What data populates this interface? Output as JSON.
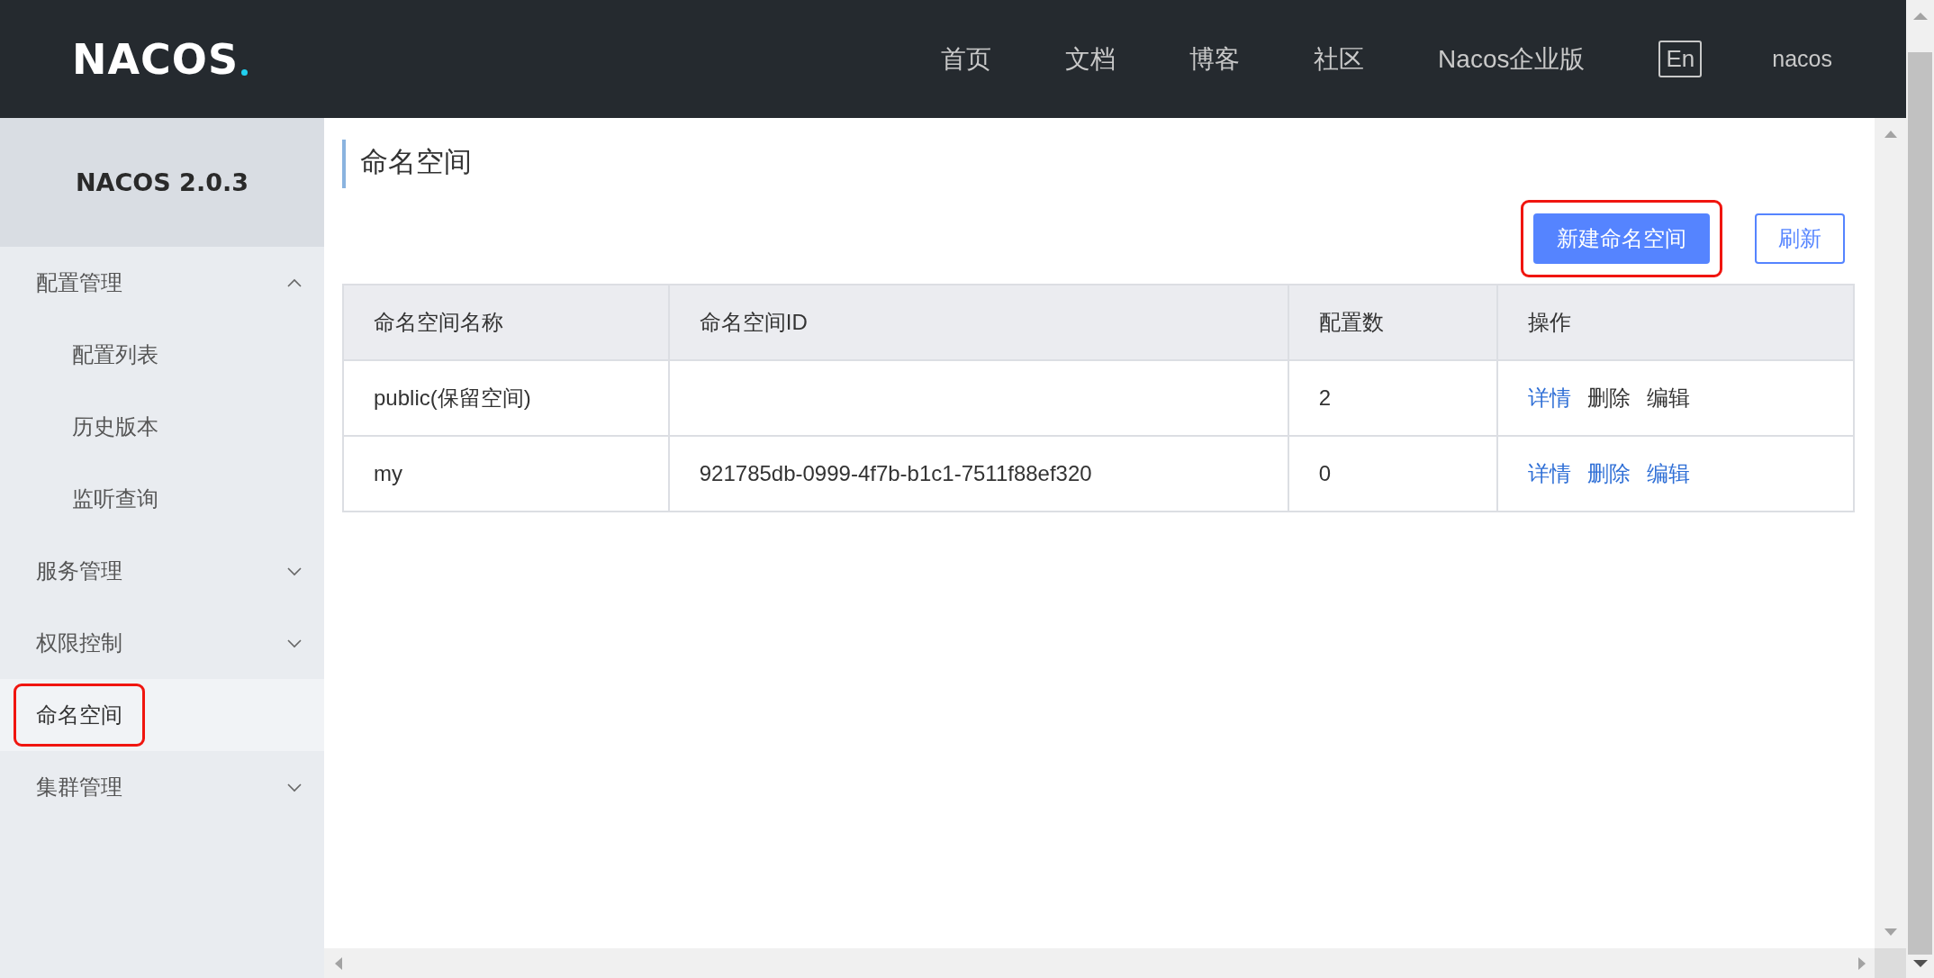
{
  "header": {
    "logo": "NACOS",
    "nav": [
      {
        "label": "首页"
      },
      {
        "label": "文档"
      },
      {
        "label": "博客"
      },
      {
        "label": "社区"
      },
      {
        "label": "Nacos企业版"
      }
    ],
    "language": "En",
    "user": "nacos"
  },
  "sidebar": {
    "title": "NACOS 2.0.3",
    "items": [
      {
        "kind": "group",
        "label": "配置管理",
        "expanded": true,
        "children": [
          {
            "label": "配置列表",
            "selected": false
          },
          {
            "label": "历史版本",
            "selected": false
          },
          {
            "label": "监听查询",
            "selected": false
          }
        ]
      },
      {
        "kind": "group",
        "label": "服务管理",
        "expanded": false
      },
      {
        "kind": "group",
        "label": "权限控制",
        "expanded": false
      },
      {
        "kind": "link",
        "label": "命名空间",
        "selected": true,
        "highlighted": true
      },
      {
        "kind": "group",
        "label": "集群管理",
        "expanded": false
      }
    ]
  },
  "page": {
    "title": "命名空间",
    "buttons": [
      {
        "kind": "primary",
        "label": "新建命名空间",
        "highlighted": true
      },
      {
        "kind": "secondary",
        "label": "刷新",
        "highlighted": false
      }
    ],
    "table": {
      "columns": [
        "命名空间名称",
        "命名空间ID",
        "配置数",
        "操作"
      ],
      "rows": [
        {
          "name": "public(保留空间)",
          "config_count": "2",
          "actions": [
            {
              "label": "详情",
              "disabled": false
            },
            {
              "label": "删除",
              "disabled": true
            },
            {
              "label": "编辑",
              "disabled": true
            }
          ]
        },
        {
          "name": "my",
          "id": "921785db-0999-4f7b-b1c1-7511f88ef320",
          "config_count": "0",
          "actions": [
            {
              "label": "详情",
              "disabled": false
            },
            {
              "label": "删除",
              "disabled": false
            },
            {
              "label": "编辑",
              "disabled": false
            }
          ]
        }
      ]
    }
  }
}
